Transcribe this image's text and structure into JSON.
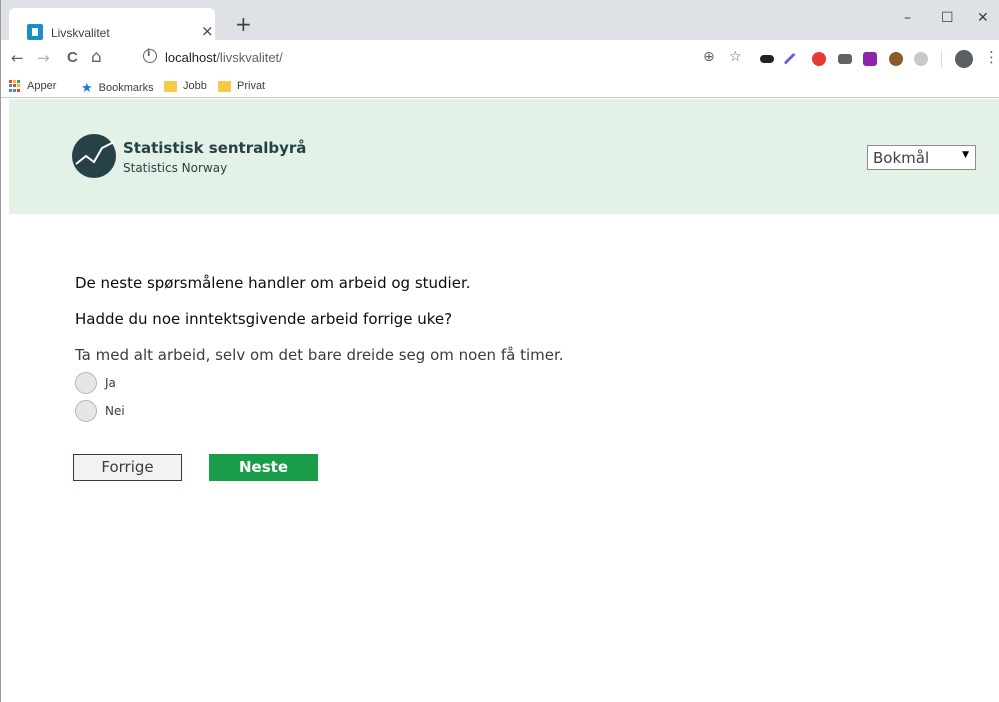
{
  "browser": {
    "tab_title": "Livskvalitet",
    "tab_close": "×",
    "new_tab": "+",
    "window_minimize": "–",
    "window_maximize": "☐",
    "window_close": "✕",
    "nav_back": "←",
    "nav_forward": "→",
    "nav_reload": "C",
    "nav_home": "⌂",
    "url_host": "localhost",
    "url_path": "/livskvalitet/",
    "zoom_icon": "⊕",
    "bookmark_star": "☆",
    "menu": "⋮",
    "bookmarks": [
      {
        "label": "Apper",
        "icon": "apps-icon"
      },
      {
        "label": "Bookmarks",
        "icon": "star-icon"
      },
      {
        "label": "Jobb",
        "icon": "folder-icon"
      },
      {
        "label": "Privat",
        "icon": "folder-icon"
      }
    ]
  },
  "header": {
    "logo_title": "Statistisk sentralbyrå",
    "logo_subtitle": "Statistics Norway",
    "language_selected": "Bokmål"
  },
  "survey": {
    "intro": "De neste spørsmålene handler om arbeid og studier.",
    "question": "Hadde du noe inntektsgivende arbeid forrige uke?",
    "help_text": "Ta med alt arbeid, selv om det bare dreide seg om noen få timer.",
    "options": [
      "Ja",
      "Nei"
    ]
  },
  "buttons": {
    "back": "Forrige",
    "next": "Neste"
  },
  "colors": {
    "header_bg": "#e3f1e6",
    "brand_dark": "#274247",
    "next_green": "#1a9d49"
  }
}
